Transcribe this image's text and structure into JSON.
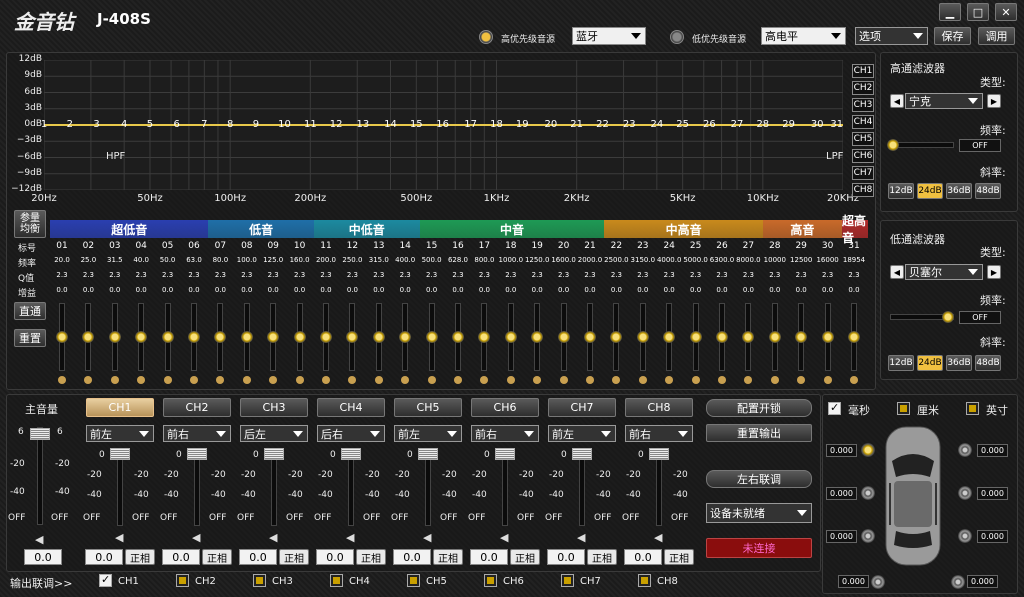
{
  "app": {
    "logo": "金音钻",
    "model": "J-408S"
  },
  "window": {
    "min": "▁",
    "max": "□",
    "close": "✕"
  },
  "toolbar": {
    "high_src_label": "高优先级音源",
    "high_src_value": "蓝牙",
    "low_src_label": "低优先级音源",
    "low_src_value": "高电平",
    "options": "选项",
    "save": "保存",
    "load": "调用"
  },
  "graph": {
    "y_ticks": [
      "12dB",
      "9dB",
      "6dB",
      "3dB",
      "0dB",
      "−3dB",
      "−6dB",
      "−9dB",
      "−12dB"
    ],
    "x_ticks": [
      "20Hz",
      "50Hz",
      "100Hz",
      "200Hz",
      "500Hz",
      "1KHz",
      "2KHz",
      "5KHz",
      "10KHz",
      "20KHz"
    ],
    "points": [
      "1",
      "2",
      "3",
      "4",
      "5",
      "6",
      "7",
      "8",
      "9",
      "10",
      "11",
      "12",
      "13",
      "14",
      "15",
      "16",
      "17",
      "18",
      "19",
      "20",
      "21",
      "22",
      "23",
      "24",
      "25",
      "26",
      "27",
      "28",
      "29",
      "30",
      "31"
    ],
    "hpf": "HPF",
    "lpf": "LPF",
    "ch_buttons": [
      "CH1",
      "CH2",
      "CH3",
      "CH4",
      "CH5",
      "CH6",
      "CH7",
      "CH8"
    ]
  },
  "chart_data": {
    "type": "line",
    "x_ticks": [
      "20Hz",
      "50Hz",
      "100Hz",
      "200Hz",
      "500Hz",
      "1KHz",
      "2KHz",
      "5KHz",
      "10KHz",
      "20KHz"
    ],
    "ylim": [
      -12,
      12
    ],
    "series": [
      {
        "values": [
          0,
          0,
          0,
          0,
          0,
          0,
          0,
          0,
          0,
          0,
          0,
          0,
          0,
          0,
          0,
          0,
          0,
          0,
          0,
          0,
          0,
          0,
          0,
          0,
          0,
          0,
          0,
          0,
          0,
          0,
          0
        ]
      }
    ]
  },
  "eq": {
    "param_eq": "参量",
    "graphic_eq": "均衡",
    "bands": [
      {
        "label": "超低音",
        "color": "#2a3fb0"
      },
      {
        "label": "低音",
        "color": "#1f6fa8"
      },
      {
        "label": "中低音",
        "color": "#1c8aa0"
      },
      {
        "label": "中音",
        "color": "#1e9a55"
      },
      {
        "label": "中高音",
        "color": "#c98a1c"
      },
      {
        "label": "高音",
        "color": "#c96a2a"
      },
      {
        "label": "超高音",
        "color": "#b02a2a"
      }
    ],
    "row_labels": {
      "index": "标号",
      "freq": "频率",
      "q": "Q值",
      "gain": "增益"
    },
    "index": [
      "01",
      "02",
      "03",
      "04",
      "05",
      "06",
      "07",
      "08",
      "09",
      "10",
      "11",
      "12",
      "13",
      "14",
      "15",
      "16",
      "17",
      "18",
      "19",
      "20",
      "21",
      "22",
      "23",
      "24",
      "25",
      "26",
      "27",
      "28",
      "29",
      "30",
      "31"
    ],
    "freq": [
      "20.0",
      "25.0",
      "31.5",
      "40.0",
      "50.0",
      "63.0",
      "80.0",
      "100.0",
      "125.0",
      "160.0",
      "200.0",
      "250.0",
      "315.0",
      "400.0",
      "500.0",
      "628.0",
      "800.0",
      "1000.0",
      "1250.0",
      "1600.0",
      "2000.0",
      "2500.0",
      "3150.0",
      "4000.0",
      "5000.0",
      "6300.0",
      "8000.0",
      "10000",
      "12500",
      "16000",
      "18954"
    ],
    "q": [
      "2.3",
      "2.3",
      "2.3",
      "2.3",
      "2.3",
      "2.3",
      "2.3",
      "2.3",
      "2.3",
      "2.3",
      "2.3",
      "2.3",
      "2.3",
      "2.3",
      "2.3",
      "2.3",
      "2.3",
      "2.3",
      "2.3",
      "2.3",
      "2.3",
      "2.3",
      "2.3",
      "2.3",
      "2.3",
      "2.3",
      "2.3",
      "2.3",
      "2.3",
      "2.3",
      "2.3"
    ],
    "gain": [
      "0.0",
      "0.0",
      "0.0",
      "0.0",
      "0.0",
      "0.0",
      "0.0",
      "0.0",
      "0.0",
      "0.0",
      "0.0",
      "0.0",
      "0.0",
      "0.0",
      "0.0",
      "0.0",
      "0.0",
      "0.0",
      "0.0",
      "0.0",
      "0.0",
      "0.0",
      "0.0",
      "0.0",
      "0.0",
      "0.0",
      "0.0",
      "0.0",
      "0.0",
      "0.0",
      "0.0"
    ],
    "bypass": "直通",
    "reset": "重置"
  },
  "hpf_panel": {
    "title": "高通滤波器",
    "type_label": "类型:",
    "type_value": "宁克",
    "freq_label": "频率:",
    "freq_value": "OFF",
    "slope_label": "斜率:",
    "slopes": [
      "12dB",
      "24dB",
      "36dB",
      "48dB"
    ],
    "active_slope": "24dB"
  },
  "lpf_panel": {
    "title": "低通滤波器",
    "type_label": "类型:",
    "type_value": "贝塞尔",
    "freq_label": "频率:",
    "freq_value": "OFF",
    "slope_label": "斜率:",
    "slopes": [
      "12dB",
      "24dB",
      "36dB",
      "48dB"
    ],
    "active_slope": "24dB"
  },
  "master": {
    "label": "主音量",
    "top": "6",
    "m20": "-20",
    "m40": "-40",
    "off": "OFF",
    "value": "0.0",
    "link_label": "输出联调>>"
  },
  "channels": [
    {
      "name": "CH1",
      "pos": "前左",
      "value": "0.0",
      "phase": "正相",
      "link": "CH1",
      "checked": true,
      "active": true
    },
    {
      "name": "CH2",
      "pos": "前右",
      "value": "0.0",
      "phase": "正相",
      "link": "CH2",
      "checked": false,
      "active": false
    },
    {
      "name": "CH3",
      "pos": "后左",
      "value": "0.0",
      "phase": "正相",
      "link": "CH3",
      "checked": false,
      "active": false
    },
    {
      "name": "CH4",
      "pos": "后右",
      "value": "0.0",
      "phase": "正相",
      "link": "CH4",
      "checked": false,
      "active": false
    },
    {
      "name": "CH5",
      "pos": "前左",
      "value": "0.0",
      "phase": "正相",
      "link": "CH5",
      "checked": false,
      "active": false
    },
    {
      "name": "CH6",
      "pos": "前右",
      "value": "0.0",
      "phase": "正相",
      "link": "CH6",
      "checked": false,
      "active": false
    },
    {
      "name": "CH7",
      "pos": "前左",
      "value": "0.0",
      "phase": "正相",
      "link": "CH7",
      "checked": false,
      "active": false
    },
    {
      "name": "CH8",
      "pos": "前右",
      "value": "0.0",
      "phase": "正相",
      "link": "CH8",
      "checked": false,
      "active": false
    }
  ],
  "fader_ticks": {
    "top": "0",
    "m20": "-20",
    "m40": "-40",
    "off": "OFF"
  },
  "controls": {
    "config_lock": "配置开锁",
    "reset_output": "重置输出",
    "lr_link": "左右联调",
    "device_status": "设备未就绪",
    "connect": "未连接"
  },
  "delay": {
    "units": [
      "毫秒",
      "厘米",
      "英寸"
    ],
    "values": [
      "0.000",
      "0.000",
      "0.000",
      "0.000",
      "0.000",
      "0.000",
      "0.000",
      "0.000"
    ]
  }
}
